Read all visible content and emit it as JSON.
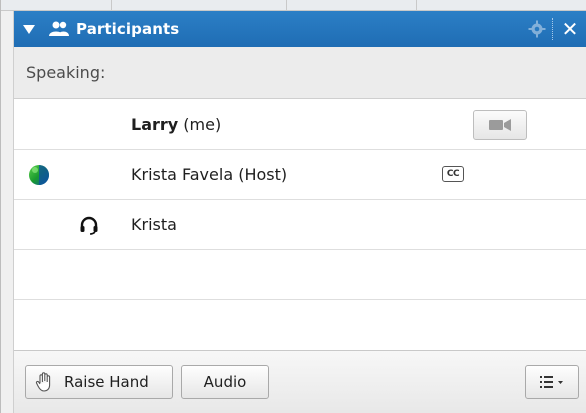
{
  "header": {
    "title": "Participants",
    "collapse_icon": "triangle-down-icon",
    "people_icon": "people-icon",
    "settings_icon": "gear-icon",
    "close_icon": "close-icon",
    "close_label": "✕"
  },
  "speaking": {
    "label": "Speaking:"
  },
  "participants": [
    {
      "name": "Larry",
      "suffix": "(me)",
      "bold": true,
      "status_icon": "",
      "audio_icon": "",
      "badge": "",
      "video_button": "camera-icon"
    },
    {
      "name": "Krista Favela (Host)",
      "suffix": "",
      "bold": false,
      "status_icon": "globe-icon",
      "audio_icon": "",
      "badge": "CC",
      "video_button": ""
    },
    {
      "name": "Krista",
      "suffix": "",
      "bold": false,
      "status_icon": "",
      "audio_icon": "headset-icon",
      "badge": "",
      "video_button": ""
    }
  ],
  "footer": {
    "raise_hand_label": "Raise Hand",
    "audio_label": "Audio",
    "raise_hand_icon": "hand-icon",
    "menu_icon": "list-menu-icon"
  },
  "colors": {
    "header_bg": "#2577bf",
    "accent_blue": "#1f6db4"
  }
}
